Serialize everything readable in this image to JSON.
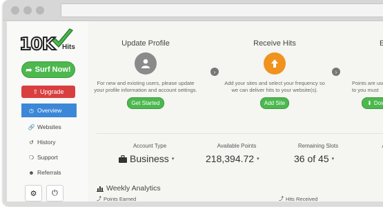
{
  "logo": {
    "brand": "10K",
    "suffix": "Hits"
  },
  "sidebar": {
    "surf_label": "Surf Now!",
    "upgrade_label": "Upgrade",
    "items": [
      {
        "label": "Overview",
        "icon": "dashboard-icon",
        "active": true
      },
      {
        "label": "Websites",
        "icon": "link-icon"
      },
      {
        "label": "History",
        "icon": "history-icon"
      },
      {
        "label": "Support",
        "icon": "lifebuoy-icon"
      },
      {
        "label": "Referrals",
        "icon": "users-icon"
      }
    ],
    "settings_icon": "gear-icon",
    "power_icon": "power-icon"
  },
  "steps": [
    {
      "title": "Update Profile",
      "desc": "For new and existing users, please update your profile information and account settings.",
      "button": "Get Started",
      "icon": "user-icon",
      "color": "#8a8a8a"
    },
    {
      "title": "Receive Hits",
      "desc": "Add your sites and select your frequency so we can deliver hits to your website(s).",
      "button": "Add Site",
      "icon": "upload-icon",
      "color": "#f0921e"
    },
    {
      "title": "Ea",
      "desc": "Points are used to you must",
      "button": "Dow",
      "icon": "download-icon",
      "color": "#4cb84e"
    }
  ],
  "stats": [
    {
      "label": "Account Type",
      "value": "Business",
      "icon": "briefcase-icon"
    },
    {
      "label": "Available Points",
      "value": "218,394.72"
    },
    {
      "label": "Remaining Slots",
      "value": "36 of 45"
    },
    {
      "label": "A",
      "value": ""
    }
  ],
  "analytics": {
    "title": "Weekly Analytics",
    "legend": [
      "Points Earned",
      "Hits Received"
    ]
  },
  "colors": {
    "accent_green": "#4cb84e",
    "accent_blue": "#3c87d8",
    "accent_red": "#d93f3f",
    "accent_orange": "#f0921e"
  }
}
